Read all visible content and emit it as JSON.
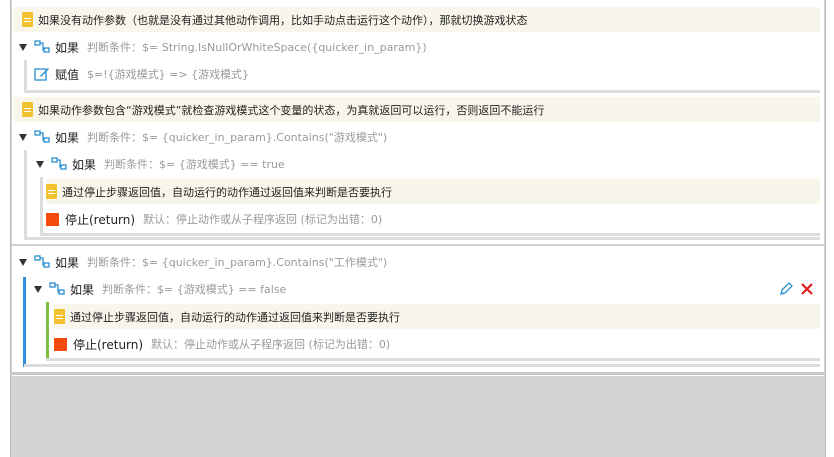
{
  "rows": {
    "note1": "如果没有动作参数（也就是没有通过其他动作调用，比如手动点击运行这个动作），那就切换游戏状态",
    "if1_kw": "如果",
    "if1_cond": "判断条件：$= String.IsNullOrWhiteSpace({quicker_in_param})",
    "assign_kw": "赋值",
    "assign_expr": "$=!{游戏模式} => {游戏模式}",
    "note2": "如果动作参数包含“游戏模式”就检查游戏模式这个变量的状态，为真就返回可以运行，否则返回不能运行",
    "if2_kw": "如果",
    "if2_cond": "判断条件：$= {quicker_in_param}.Contains(\"游戏模式\")",
    "if2a_kw": "如果",
    "if2a_cond": "判断条件：$= {游戏模式} == true",
    "note3": "通过停止步骤返回值，自动运行的动作通过返回值来判断是否要执行",
    "stop1_kw": "停止(return)",
    "stop1_desc": "默认：停止动作或从子程序返回 (标记为出错：0)",
    "if3_kw": "如果",
    "if3_cond": "判断条件：$= {quicker_in_param}.Contains(\"工作模式\")",
    "if3a_kw": "如果",
    "if3a_cond": "判断条件：$= {游戏模式} == false",
    "note4": "通过停止步骤返回值，自动运行的动作通过返回值来判断是否要执行",
    "stop2_kw": "停止(return)",
    "stop2_desc": "默认：停止动作或从子程序返回 (标记为出错：0)"
  },
  "icons": {
    "note": "note-icon",
    "branch": "branch-icon",
    "edit": "edit-icon",
    "stop": "stop-icon",
    "pencil": "pencil-icon",
    "close": "close-icon"
  },
  "colors": {
    "note_bg": "#f8f5ea",
    "note_icon": "#f2c230",
    "branch_icon": "#2a8fd1",
    "stop_icon": "#f24b0c",
    "selection_bar": "#2e8ee0",
    "selected_inner_bar": "#7fbf3f",
    "close_icon": "#e02020"
  }
}
